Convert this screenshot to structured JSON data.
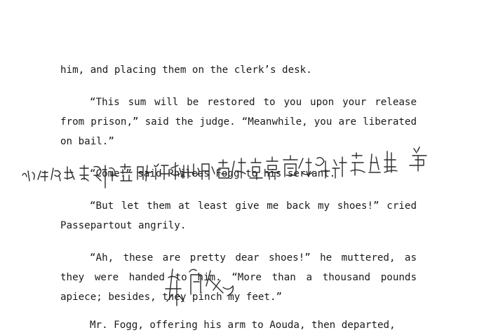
{
  "document": {
    "paragraphs": [
      {
        "id": "p1",
        "text": "him, and placing them on the clerk’s desk."
      },
      {
        "id": "p2",
        "text": "“This sum will be restored to you upon your release from prison,” said the judge. “Meanwhile, you are liberated on bail.”"
      },
      {
        "id": "p3",
        "text": "“Come!” said Phileas Fogg to his servant."
      },
      {
        "id": "p4",
        "text": "“But let them at least give me back my shoes!” cried Passepartout angrily."
      },
      {
        "id": "p5",
        "text": "“Ah, these are pretty dear shoes!” he muttered, as they were handed to him. “More than a thousand pounds apiece; besides, they pinch my feet.”"
      },
      {
        "id": "p6",
        "text": "Mr. Fogg, offering his arm to Aouda, then departed,"
      }
    ]
  },
  "handwriting": {
    "line1": "以往的考古研究表明，俗而化地且不是最烈煌莫高窟的创建时期，第",
    "line2": "宋代"
  }
}
